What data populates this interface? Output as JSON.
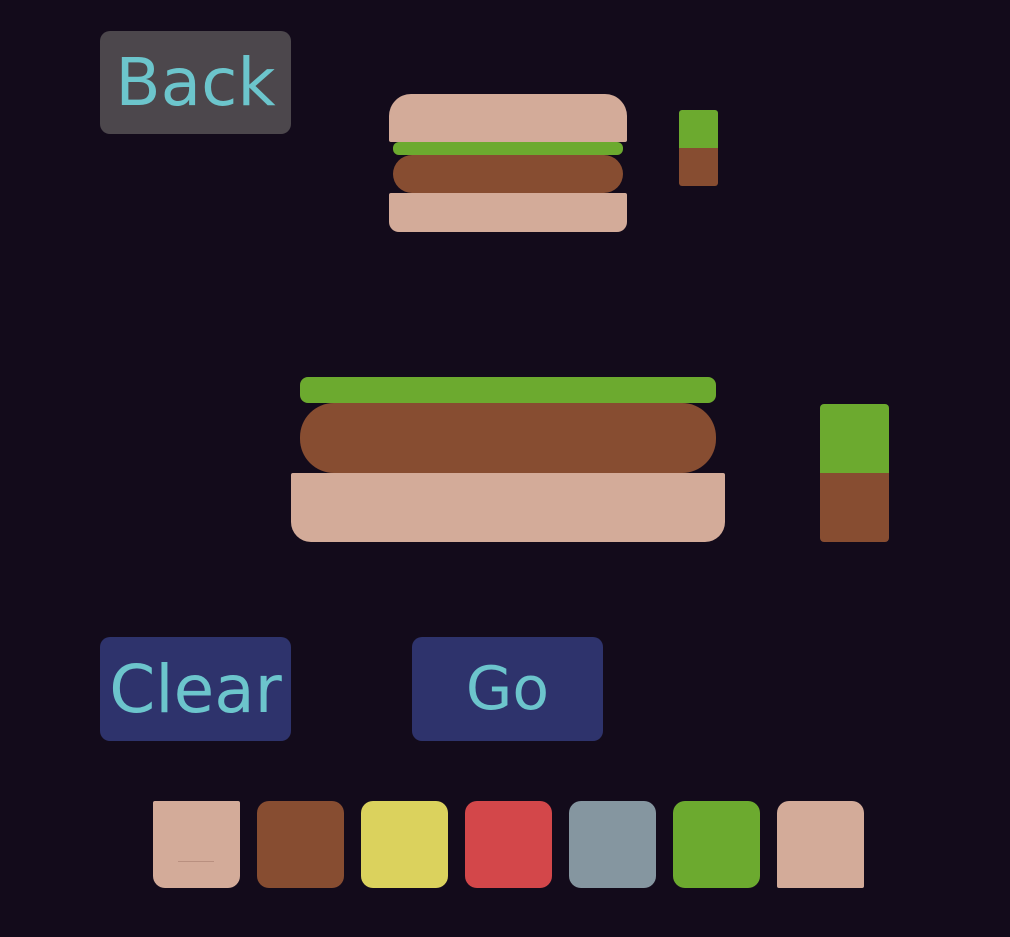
{
  "buttons": {
    "back_label": "Back",
    "clear_label": "Clear",
    "go_label": "Go"
  },
  "colors": {
    "background": "#130b1b",
    "bun": "#d3ab99",
    "lettuce": "#6caa2f",
    "patty": "#874d31",
    "cheese": "#dbd25d",
    "tomato": "#d3474a",
    "plate": "#8596a0",
    "button_dark": "#4c474c",
    "button_blue": "#2e336c",
    "button_text": "#6cc5cc"
  },
  "target_burger": {
    "layers_top_to_bottom": [
      "bun-top",
      "lettuce",
      "patty",
      "bun-bottom"
    ],
    "indicator": [
      "lettuce",
      "patty"
    ]
  },
  "player_burger": {
    "layers_top_to_bottom": [
      "lettuce",
      "patty",
      "bun-bottom"
    ],
    "indicator": [
      "lettuce",
      "patty"
    ]
  },
  "palette": [
    {
      "ingredient": "bun-bottom",
      "color": "#d3ab99"
    },
    {
      "ingredient": "patty",
      "color": "#874d31"
    },
    {
      "ingredient": "cheese",
      "color": "#dbd25d"
    },
    {
      "ingredient": "tomato",
      "color": "#d3474a"
    },
    {
      "ingredient": "plate",
      "color": "#8596a0"
    },
    {
      "ingredient": "lettuce",
      "color": "#6caa2f"
    },
    {
      "ingredient": "bun-top",
      "color": "#d3ab99"
    }
  ]
}
